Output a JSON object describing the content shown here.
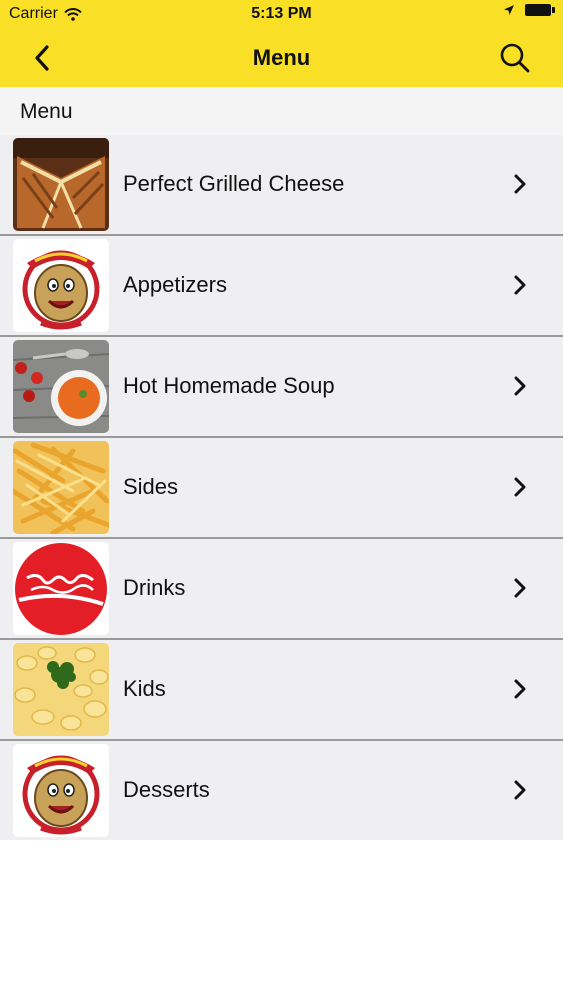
{
  "status_bar": {
    "carrier": "Carrier",
    "time": "5:13 PM"
  },
  "nav": {
    "title": "Menu",
    "back_icon": "chevron-left-icon",
    "search_icon": "search-icon"
  },
  "section": {
    "title": "Menu"
  },
  "menu_items": [
    {
      "label": "Perfect Grilled Cheese",
      "image": "grilled-cheese-image"
    },
    {
      "label": "Appetizers",
      "image": "cassies-logo-image"
    },
    {
      "label": "Hot Homemade Soup",
      "image": "soup-image"
    },
    {
      "label": "Sides",
      "image": "fries-image"
    },
    {
      "label": "Drinks",
      "image": "coca-cola-logo-image"
    },
    {
      "label": "Kids",
      "image": "mac-and-cheese-image"
    },
    {
      "label": "Desserts",
      "image": "cassies-logo-image"
    }
  ],
  "colors": {
    "nav_background": "#f9df26",
    "row_background": "#efeff1",
    "separator": "#9a9a9a"
  }
}
